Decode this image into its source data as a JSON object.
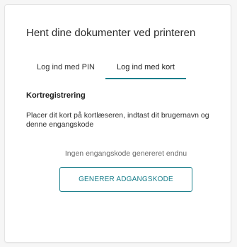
{
  "panel": {
    "title": "Hent dine dokumenter ved printeren"
  },
  "tabs": [
    {
      "label": "Log ind med PIN",
      "active": false
    },
    {
      "label": "Log ind med kort",
      "active": true
    }
  ],
  "card_registration": {
    "heading": "Kortregistrering",
    "instructions": "Placer dit kort på kortlæseren, indtast dit brugernavn og denne engangskode",
    "status": "Ingen engangskode genereret endnu",
    "generate_button_label": "GENERER ADGANGSKODE"
  },
  "colors": {
    "accent": "#1b7f8c",
    "background": "#f6f6f6",
    "panel": "#ffffff"
  }
}
